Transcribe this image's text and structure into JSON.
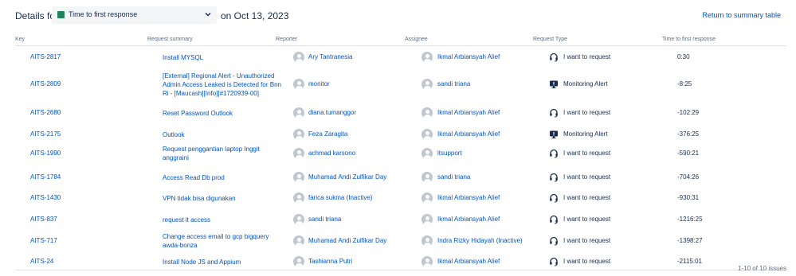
{
  "header": {
    "details_label": "Details for",
    "metric": "Time to first response",
    "metric_color": "#1f845a",
    "date_label": "on Oct 13, 2023",
    "return_link": "Return to summary table"
  },
  "table": {
    "columns": [
      "Key",
      "Request summary",
      "Reporter",
      "Assignee",
      "Request Type",
      "Time to first response"
    ],
    "rows": [
      {
        "key": "AITS-2817",
        "summary": "Install MYSQL",
        "reporter": "Ary Tantranesia",
        "assignee": "Ikmal Arbiansyah Alief",
        "type": "I want to request",
        "type_icon": "headset-icon",
        "time": "0:30"
      },
      {
        "key": "AITS-2809",
        "summary": "[External] Regional Alert - Unauthorized Admin Access Leaked is Detected for Bnn Ri - [Maucash][Info][#1720939-00]",
        "reporter": "monitor",
        "assignee": "sandi triana",
        "type": "Monitoring Alert",
        "type_icon": "monitor-alert-icon",
        "time": "-8:25"
      },
      {
        "key": "AITS-2680",
        "summary": "Reset Password Outlook",
        "reporter": "diana.tumanggor",
        "assignee": "Ikmal Arbiansyah Alief",
        "type": "I want to request",
        "type_icon": "headset-icon",
        "time": "-102:29"
      },
      {
        "key": "AITS-2175",
        "summary": "Outlook",
        "reporter": "Feza Zaragita",
        "assignee": "Ikmal Arbiansyah Alief",
        "type": "Monitoring Alert",
        "type_icon": "monitor-alert-icon",
        "time": "-376:25"
      },
      {
        "key": "AITS-1990",
        "summary": "Request penggantian laptop Inggit anggraini",
        "reporter": "achmad karsono",
        "assignee": "itsupport",
        "type": "I want to request",
        "type_icon": "headset-icon",
        "time": "-590:21"
      },
      {
        "key": "AITS-1784",
        "summary": "Access Read Db prod",
        "reporter": "Muhamad Andi Zulfikar Day",
        "assignee": "sandi triana",
        "type": "I want to request",
        "type_icon": "headset-icon",
        "time": "-704:26"
      },
      {
        "key": "AITS-1430",
        "summary": "VPN tidak bisa digunakan",
        "reporter": "farica sukma (Inactive)",
        "assignee": "Ikmal Arbiansyah Alief",
        "type": "I want to request",
        "type_icon": "headset-icon",
        "time": "-930:31"
      },
      {
        "key": "AITS-837",
        "summary": "request it access",
        "reporter": "sandi triana",
        "assignee": "Ikmal Arbiansyah Alief",
        "type": "I want to request",
        "type_icon": "headset-icon",
        "time": "-1216:25"
      },
      {
        "key": "AITS-717",
        "summary": "Change access email to gcp bigquery awda-bonza",
        "reporter": "Muhamad Andi Zulfikar Day",
        "assignee": "Indra Rizky Hidayah (Inactive)",
        "type": "I want to request",
        "type_icon": "headset-icon",
        "time": "-1398:27"
      },
      {
        "key": "AITS-24",
        "summary": "Install Node JS and Appium",
        "reporter": "Tashianna Putri",
        "assignee": "Ikmal Arbiansyah Alief",
        "type": "I want to request",
        "type_icon": "headset-icon",
        "time": "-2115:01"
      }
    ]
  },
  "pagination": "1-10 of 10 issues"
}
